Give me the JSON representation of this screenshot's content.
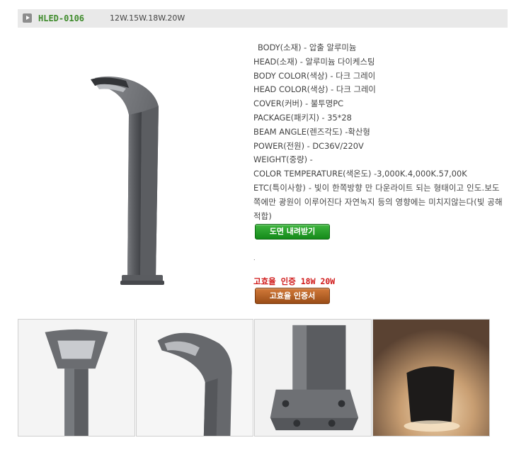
{
  "header": {
    "model_code": "HLED-0106",
    "wattages": "12W.15W.18W.20W"
  },
  "specs": {
    "body": "BODY(소재) - 압출 알루미늄",
    "head": "HEAD(소재) - 알루미늄 다이케스팅",
    "body_color": "BODY COLOR(색상) - 다크 그레이",
    "head_color": "HEAD COLOR(색상) - 다크 그레이",
    "cover": "COVER(커버) - 불투명PC",
    "package": "PACKAGE(패키지) - 35*28",
    "beam_angle": "BEAM ANGLE(렌즈각도) -확산형",
    "power": "POWER(전원) - DC36V/220V",
    "weight": "WEIGHT(중량) -",
    "color_temperature": "COLOR TEMPERATURE(색온도) -3,000K.4,000K.57,00K",
    "etc": "ETC(특이사항) - 빛이 한쪽방향 만 다운라이트 되는 형태이고 인도.보도 쪽에만 광원이 이루어진다 자연녹지 등의 영향에는 미치지않는다(빛 공해 적합)"
  },
  "buttons": {
    "download": "도면 내려받기",
    "certificate": "고효율 인증서"
  },
  "misc": {
    "dot": ".",
    "cert_title": "고효율 인증 18W 20W"
  },
  "colors": {
    "model_code": "#3f8b2c",
    "cert_title": "#d01a1a",
    "download_button": "#1f9a24",
    "certificate_button": "#b25f22",
    "header_bar": "#e9e9e9"
  },
  "thumbnails": [
    {
      "icon": "lamp-head-front-icon"
    },
    {
      "icon": "lamp-head-side-icon"
    },
    {
      "icon": "lamp-base-icon"
    },
    {
      "icon": "lamp-night-glow-icon"
    }
  ]
}
